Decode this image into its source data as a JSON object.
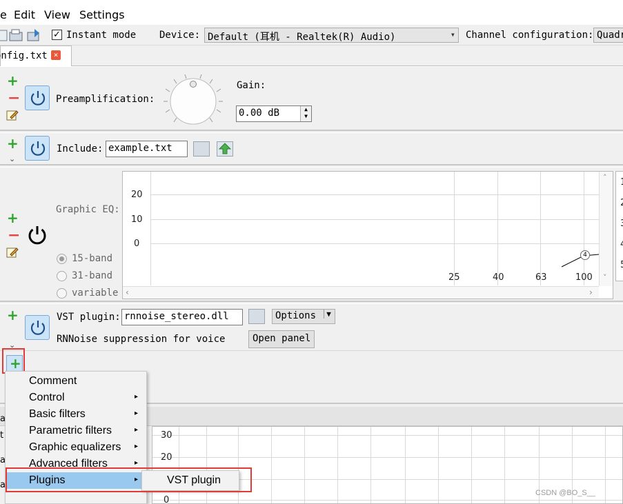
{
  "menubar": {
    "items": [
      "e",
      "Edit",
      "View",
      "Settings"
    ]
  },
  "toolbar": {
    "instant_mode_label": "Instant mode",
    "instant_mode_checked": "✓",
    "device_label": "Device:",
    "device_value": "Default (耳机 - Realtek(R) Audio)",
    "channel_label": "Channel configuration:",
    "channel_value": "Quadr"
  },
  "tab": {
    "label": "onfig.txt",
    "close": "×"
  },
  "preamp": {
    "label": "Preamplification:",
    "gain_label": "Gain:",
    "gain_value": "0.00 dB"
  },
  "include": {
    "label": "Include:",
    "value": "example.txt"
  },
  "graphic_eq": {
    "label": "Graphic EQ:",
    "options": [
      "15-band",
      "31-band",
      "variable"
    ],
    "y_ticks": [
      "20",
      "10",
      "0"
    ],
    "x_ticks": [
      "25",
      "40",
      "63",
      "100"
    ],
    "marker": "4",
    "table_digits": [
      "1",
      "2",
      "3",
      "4",
      "5"
    ]
  },
  "vst": {
    "label": "VST plugin:",
    "value": "rnnoise_stereo.dll",
    "options_label": "Options",
    "description": "RNNoise suppression for voice",
    "open_panel_label": "Open panel"
  },
  "bottom_graph": {
    "y_ticks": [
      "30",
      "20",
      "0"
    ],
    "left_letters": [
      "a",
      "t",
      "a",
      "a"
    ]
  },
  "context_menu": {
    "items": [
      {
        "label": "Comment",
        "sub": ""
      },
      {
        "label": "Control",
        "sub": "▸"
      },
      {
        "label": "Basic filters",
        "sub": "▸"
      },
      {
        "label": "Parametric filters",
        "sub": "▸"
      },
      {
        "label": "Graphic equalizers",
        "sub": "▸"
      },
      {
        "label": "Advanced filters",
        "sub": "▸"
      },
      {
        "label": "Plugins",
        "sub": "▸"
      }
    ],
    "submenu_item": "VST plugin"
  },
  "watermark": "CSDN @BO_S__",
  "colors": {
    "highlight": "#99c9ef",
    "annotation": "#e53935",
    "plus": "#2da52d",
    "minus": "#e24a4a"
  }
}
